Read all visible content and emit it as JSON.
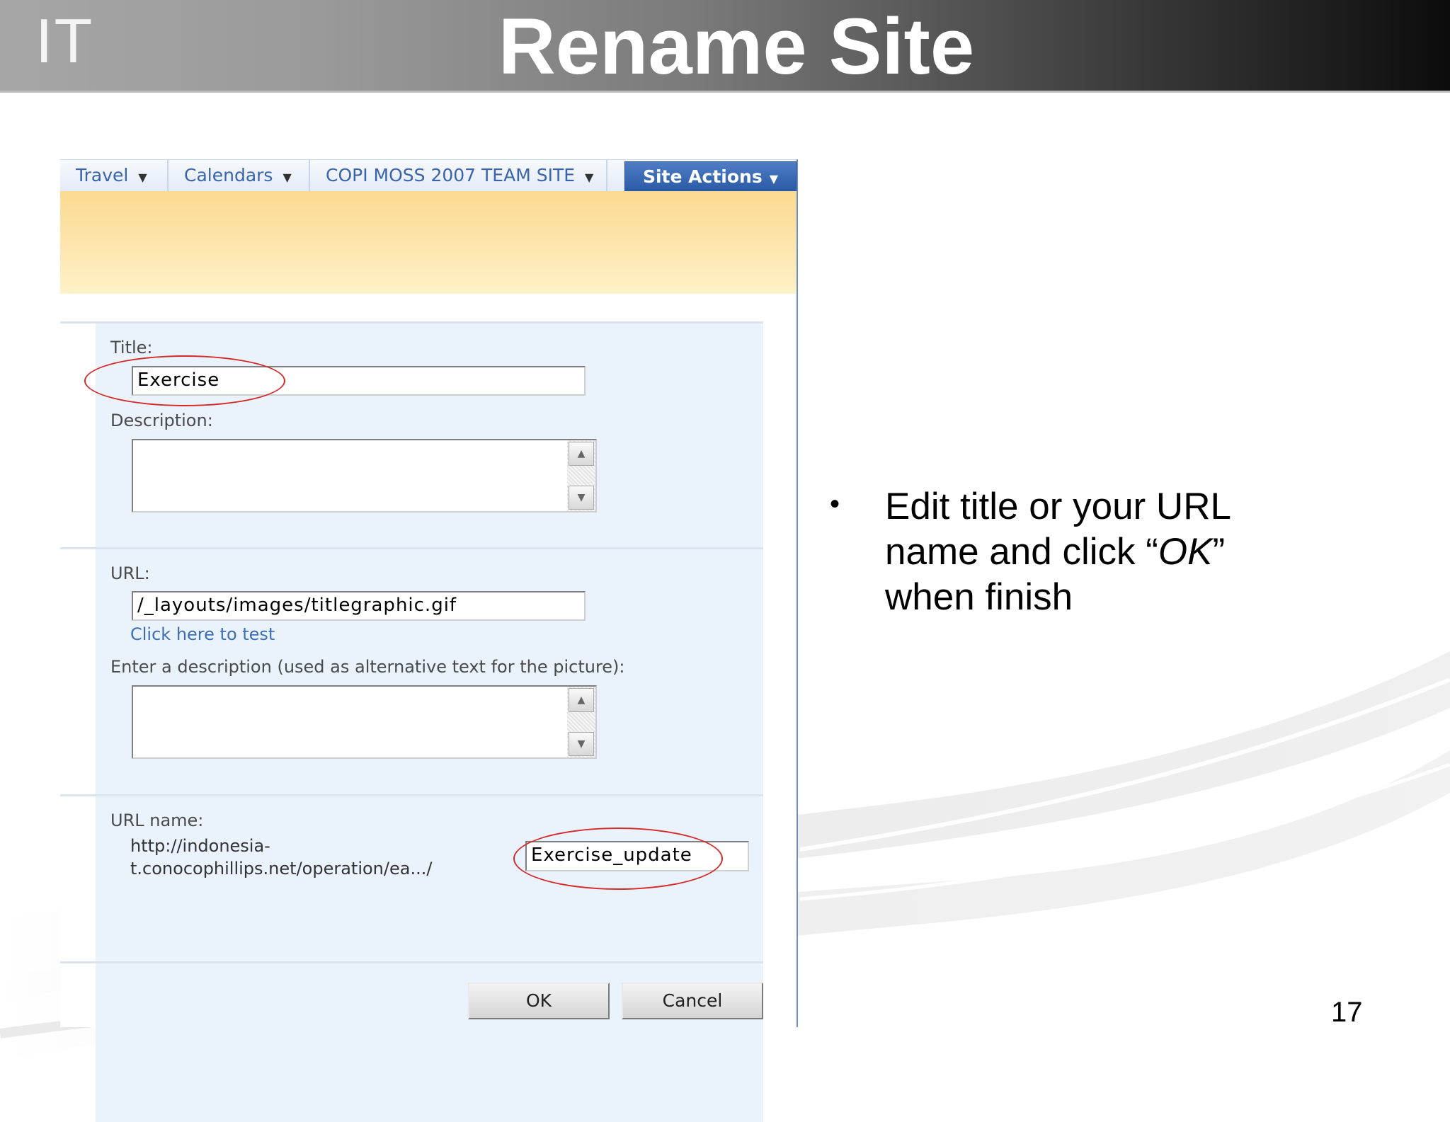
{
  "slide": {
    "logo": "IT",
    "title": "Rename Site",
    "page_number": "17",
    "bullet": {
      "text_before": "Edit title or your URL name and click “",
      "emphasis": "OK",
      "text_after": "” when finish"
    }
  },
  "nav": {
    "items": [
      {
        "label": "Travel"
      },
      {
        "label": "Calendars"
      },
      {
        "label": "COPI MOSS 2007 TEAM SITE"
      }
    ],
    "site_actions": "Site Actions"
  },
  "form": {
    "title_label": "Title:",
    "title_value": "Exercise",
    "description_label": "Description:",
    "url_label": "URL:",
    "url_value": "/_layouts/images/titlegraphic.gif",
    "test_link": "Click here to test",
    "alt_label": "Enter a description (used as alternative text for the picture):",
    "url_name_label": "URL name:",
    "url_prefix_line1": "http://indonesia-",
    "url_prefix_line2": "t.conocophillips.net/operation/ea.../",
    "url_name_value": "Exercise_update",
    "ok_label": "OK",
    "cancel_label": "Cancel"
  },
  "colors": {
    "site_actions_bg": "#2a5aa6",
    "banner": "#fbd991",
    "form_bg": "#eaf2fc",
    "highlight_circle": "#d42a2a"
  },
  "icons": {
    "caret": "dropdown-caret-icon",
    "scroll_up": "scroll-up-arrow-icon",
    "scroll_down": "scroll-down-arrow-icon"
  }
}
